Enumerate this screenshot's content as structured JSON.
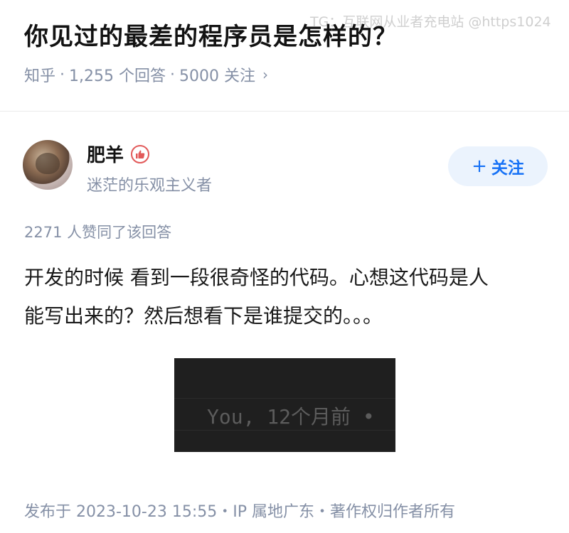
{
  "watermark": "TG：互联网从业者充电站 @https1024",
  "question": {
    "title": "你见过的最差的程序员是怎样的？",
    "source": "知乎",
    "answers": "1,255 个回答",
    "followers": "5000 关注",
    "chevron": "›"
  },
  "author": {
    "name": "肥羊",
    "bio": "迷茫的乐观主义者",
    "badge_icon": "thumbs-up-badge-icon",
    "follow_plus": "+",
    "follow_label": "关注"
  },
  "answer": {
    "likes": "2271 人赞同了该回答",
    "paragraph_line1": "开发的时候 看到一段很奇怪的代码。心想这代码是人",
    "paragraph_line2": "能写出来的？然后想看下是谁提交的。。。",
    "image_text": "You, 12个月前 •"
  },
  "footer": {
    "text": "发布于 2023-10-23 15:55・IP 属地广东・著作权归作者所有"
  },
  "colors": {
    "accent": "#1772f6",
    "follow_bg": "#ebf3fd",
    "meta_gray": "#8590a6",
    "badge_red": "#e25a5a"
  }
}
